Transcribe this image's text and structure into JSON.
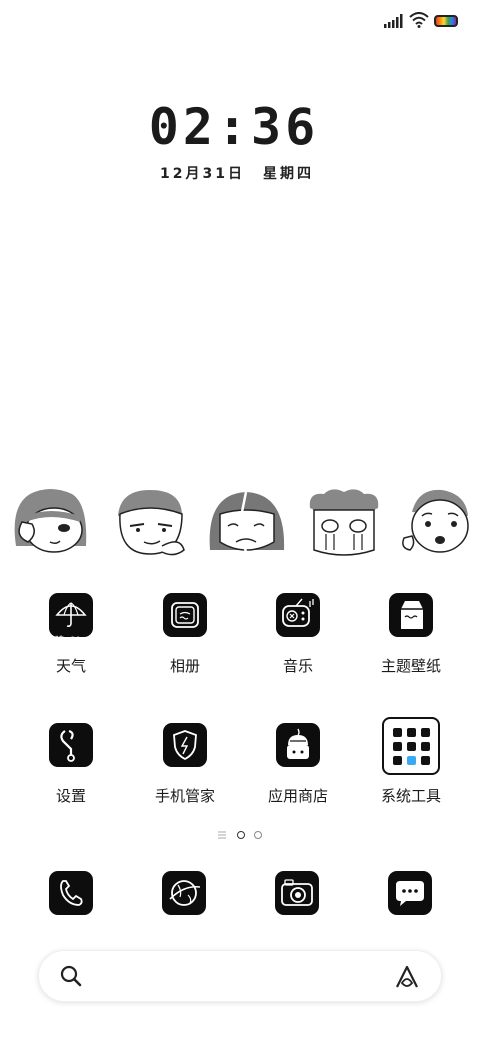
{
  "clock": {
    "time": "02:36",
    "date": "12月31日",
    "weekday": "星期四"
  },
  "apps": [
    {
      "label": "天气",
      "icon": "umbrella-icon",
      "badge": "晴 -1°"
    },
    {
      "label": "相册",
      "icon": "photo-frame-icon"
    },
    {
      "label": "音乐",
      "icon": "radio-icon"
    },
    {
      "label": "主题壁纸",
      "icon": "milk-carton-icon"
    },
    {
      "label": "设置",
      "icon": "wrench-icon"
    },
    {
      "label": "手机管家",
      "icon": "shield-icon"
    },
    {
      "label": "应用商店",
      "icon": "shop-bag-icon"
    },
    {
      "label": "系统工具",
      "icon": "folder-grid-icon"
    }
  ],
  "dock": [
    {
      "icon": "phone-icon"
    },
    {
      "icon": "browser-globe-icon"
    },
    {
      "icon": "camera-icon"
    },
    {
      "icon": "message-bubble-icon"
    }
  ],
  "page_indicator": {
    "pages": 3,
    "current": 1
  },
  "colors": {
    "tile": "#0d0d0d",
    "accent": "#3aa9ef"
  }
}
